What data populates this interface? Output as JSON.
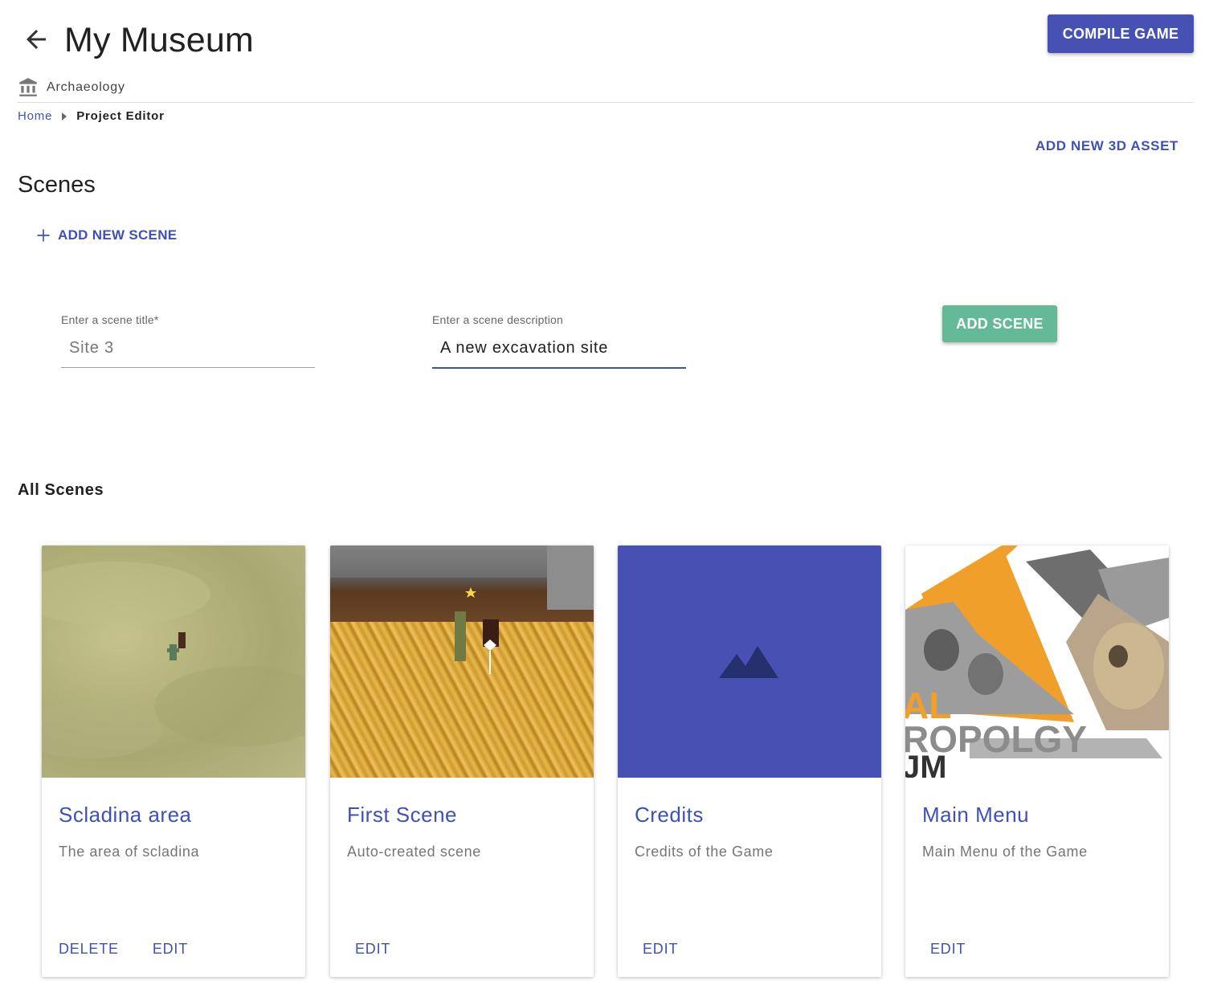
{
  "header": {
    "title": "My Museum",
    "compile_label": "COMPILE GAME",
    "category": "Archaeology"
  },
  "breadcrumb": {
    "home": "Home",
    "current": "Project Editor"
  },
  "toolbar": {
    "add_asset_label": "ADD NEW 3D ASSET"
  },
  "scenes_section": {
    "title": "Scenes",
    "add_new_label": "ADD NEW SCENE"
  },
  "form": {
    "title_label": "Enter a scene title*",
    "title_value": "Site 3",
    "description_label": "Enter a scene description",
    "description_value": "A new excavation site",
    "submit_label": "ADD SCENE"
  },
  "all_scenes": {
    "heading": "All Scenes",
    "cards": [
      {
        "title": "Scladina area",
        "description": "The area of scladina",
        "actions": [
          "DELETE",
          "EDIT"
        ]
      },
      {
        "title": "First Scene",
        "description": "Auto-created scene",
        "actions": [
          "EDIT"
        ]
      },
      {
        "title": "Credits",
        "description": "Credits of the Game",
        "actions": [
          "EDIT"
        ]
      },
      {
        "title": "Main Menu",
        "description": "Main Menu of the Game",
        "actions": [
          "EDIT"
        ]
      }
    ]
  },
  "menu_poster_text": [
    "AL",
    "ROPOLGY",
    "JM"
  ],
  "colors": {
    "primary": "#3f51b5",
    "primary_button": "#4751b3",
    "success_button": "#64b996",
    "accent_orange": "#f0a02a"
  },
  "icons": {
    "back": "arrow-left-icon",
    "category": "museum-icon",
    "breadcrumb_separator": "chevron-right-icon",
    "add": "plus-icon",
    "credits_placeholder": "mountains-icon"
  }
}
